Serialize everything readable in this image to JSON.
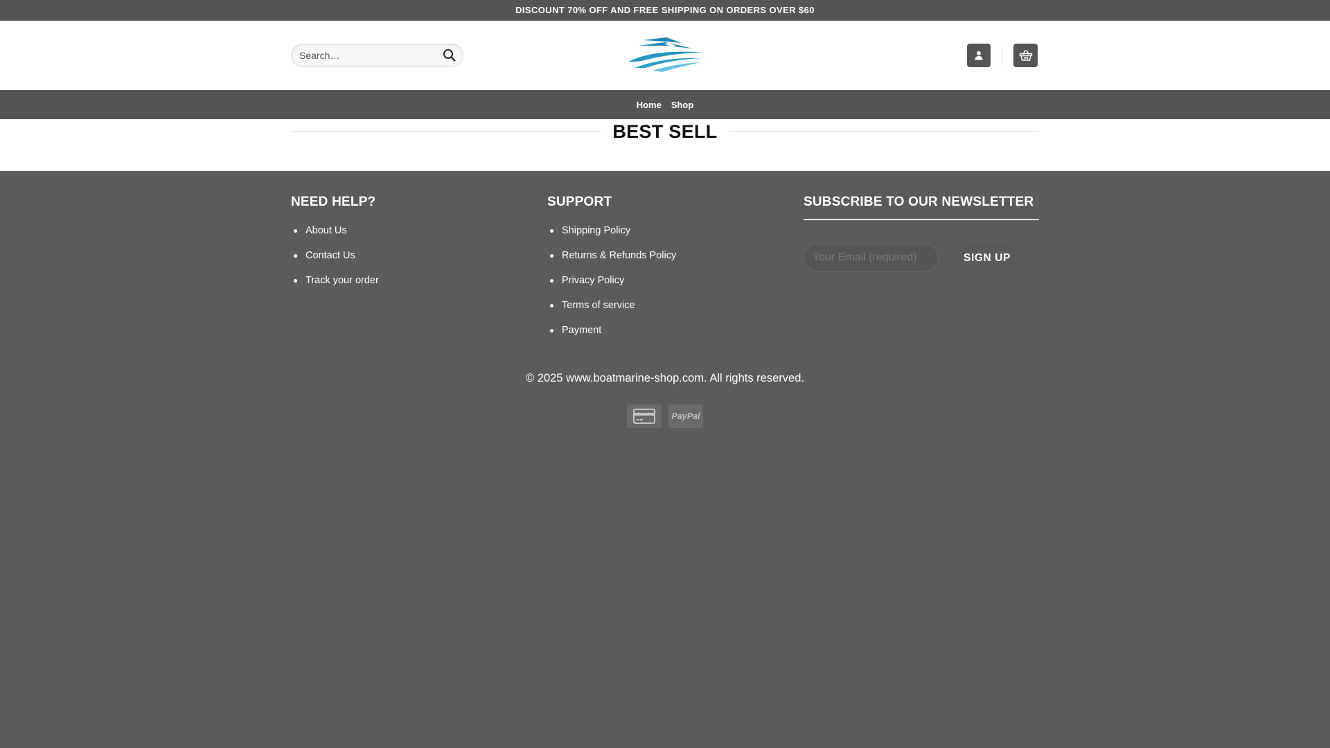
{
  "topbar": {
    "text": "DISCOUNT 70% OFF AND FREE SHIPPING ON ORDERS OVER $60"
  },
  "header": {
    "search_placeholder": "Search…",
    "logo_icon": "boat-logo-icon",
    "account_icon": "user-icon",
    "cart_icon": "basket-icon"
  },
  "nav": {
    "items": [
      {
        "label": "Home"
      },
      {
        "label": "Shop"
      }
    ]
  },
  "content": {
    "section_title": "BEST SELL"
  },
  "footer": {
    "help": {
      "title": "NEED HELP?",
      "links": [
        "About Us",
        "Contact Us",
        "Track your order"
      ]
    },
    "support": {
      "title": "SUPPORT",
      "links": [
        "Shipping Policy",
        "Returns & Refunds Policy",
        "Privacy Policy",
        "Terms of service",
        "Payment"
      ]
    },
    "newsletter": {
      "title": "SUBSCRIBE TO OUR NEWSLETTER",
      "email_placeholder": "Your Email (required)",
      "signup_label": "SIGN UP"
    },
    "copyright": "© 2025 www.boatmarine-shop.com. All rights reserved.",
    "payments": [
      {
        "icon": "credit-card-icon"
      },
      {
        "label": "PayPal"
      }
    ]
  },
  "colors": {
    "dark_gray": "#555555",
    "footer_bg": "#5b5b5b",
    "logo_blue": "#2596be"
  }
}
